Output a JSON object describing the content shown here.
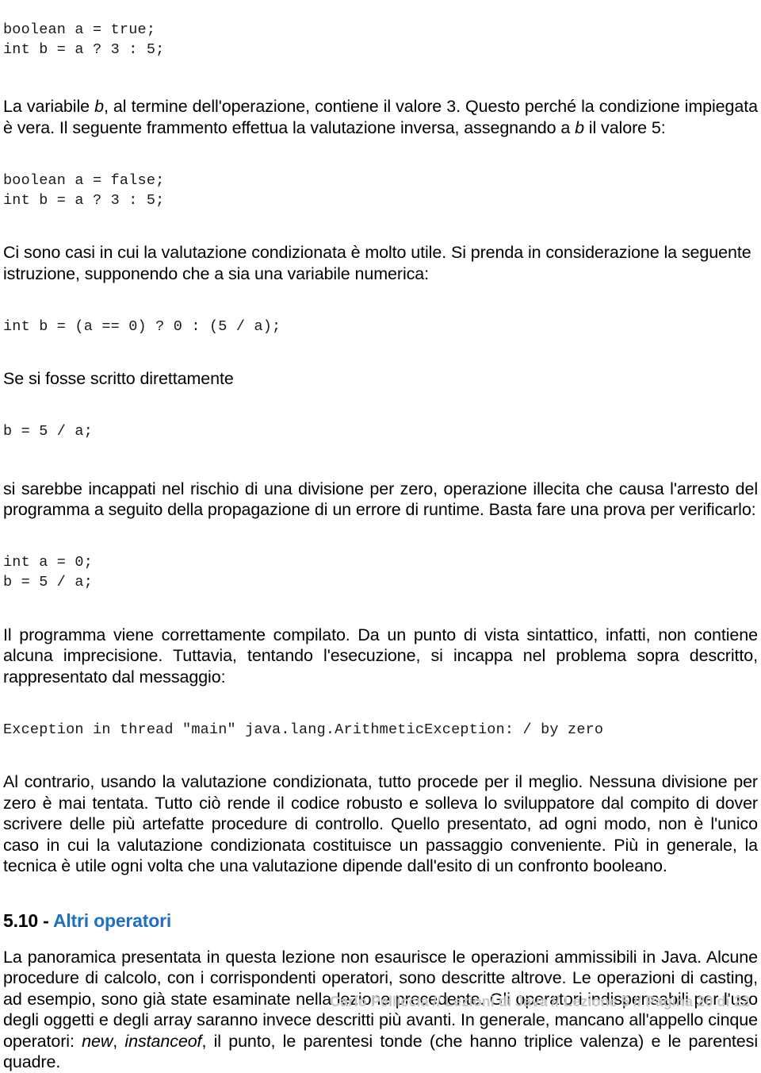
{
  "document": {
    "blocks": {
      "code1": "boolean a = true;\nint b = a ? 3 : 5;",
      "para1_a": "La variabile ",
      "para1_i": "b",
      "para1_b": ", al termine dell'operazione, contiene il valore 3. Questo perché la condizione impiegata è vera. Il seguente frammento effettua la valutazione inversa, assegnando a ",
      "para1_i2": "b",
      "para1_c": " il valore 5:",
      "code2": "boolean a = false;\nint b = a ? 3 : 5;",
      "para2": "Ci sono casi in cui la valutazione condizionata è molto utile. Si prenda in considerazione la seguente istruzione, supponendo che a sia una variabile numerica:",
      "code3": "int b = (a == 0) ? 0 : (5 / a);",
      "para3": "Se si fosse scritto direttamente",
      "code4": "b = 5 / a;",
      "para4": "si sarebbe incappati nel rischio di una divisione per zero, operazione illecita che causa l'arresto del programma a seguito della propagazione di un errore di runtime. Basta fare una prova per verificarlo:",
      "code5": "int a = 0;\nb = 5 / a;",
      "para5": "Il programma viene correttamente compilato. Da un punto di vista sintattico, infatti, non contiene alcuna imprecisione. Tuttavia, tentando l'esecuzione, si incappa nel problema sopra descritto, rappresentato dal messaggio:",
      "code6": "Exception in thread \"main\" java.lang.ArithmeticException: / by zero",
      "para6": "Al contrario, usando la valutazione condizionata, tutto procede per il meglio. Nessuna divisione per zero è mai tentata. Tutto ciò rende il codice robusto e solleva lo sviluppatore dal compito di dover scrivere delle più artefatte procedure di controllo. Quello presentato, ad ogni modo, non è l'unico caso in cui la valutazione condizionata costituisce un passaggio conveniente. Più in generale, la tecnica è utile ogni volta che una valutazione dipende dall'esito di un confronto booleano."
    },
    "section": {
      "number": "5.10 - ",
      "title": "Altri operatori",
      "accent_color": "#1f6fc4",
      "para_a": "La panoramica presentata in questa lezione non esaurisce le operazioni ammissibili in Java. Alcune procedure di calcolo, con i corrispondenti operatori, sono descritte altrove. Le operazioni di casting, ad esempio, sono già state esaminate nella lezione precedente. Gli operatori indispensabili per l'uso degli oggetti e degli array saranno invece descritti più avanti. In generale, mancano all'appello cinque operatori: ",
      "ital_new": "new",
      "sep1": ", ",
      "ital_instanceof": "instanceof",
      "para_b": ", il punto, le parentesi tonde (che hanno triplice valenza) e le parentesi quadre."
    },
    "footer": {
      "text": "Carlo Pelliccia // Lezioni di Java // Lezione 5 // Pagina 20 di 22",
      "color": "#c6c6c6"
    }
  }
}
